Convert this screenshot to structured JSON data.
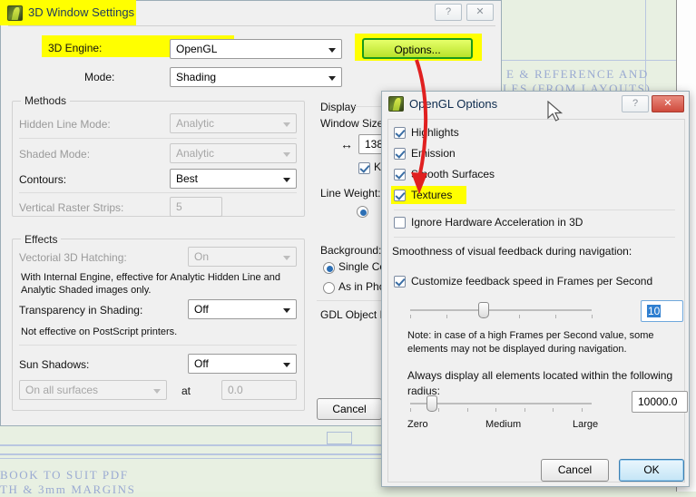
{
  "background_doc": {
    "lines": [
      "E & REFERENCE AND",
      "LES (FROM LAYOUTS)",
      "BOOK TO SUIT PDF",
      "TH & 3mm MARGINS"
    ]
  },
  "settings_window": {
    "title": "3D Window Settings",
    "title_highlighted": true,
    "help_button": "?",
    "close_button": "✕",
    "engine": {
      "label": "3D Engine:",
      "value": "OpenGL",
      "highlighted": true
    },
    "mode": {
      "label": "Mode:",
      "value": "Shading"
    },
    "options_button": {
      "label": "Options...",
      "highlighted": true
    },
    "methods": {
      "title": "Methods",
      "hidden_line_mode": {
        "label": "Hidden Line Mode:",
        "value": "Analytic",
        "disabled": true
      },
      "shaded_mode": {
        "label": "Shaded Mode:",
        "value": "Analytic",
        "disabled": true
      },
      "contours": {
        "label": "Contours:",
        "value": "Best",
        "disabled": false
      },
      "vertical_raster_strips": {
        "label": "Vertical Raster Strips:",
        "value": "5",
        "disabled": true
      }
    },
    "effects": {
      "title": "Effects",
      "vectorial_hatching": {
        "label": "Vectorial 3D Hatching:",
        "value": "On",
        "disabled": true
      },
      "hatching_note": "With Internal Engine, effective for Analytic Hidden Line and Analytic Shaded images only.",
      "transparency": {
        "label": "Transparency in Shading:",
        "value": "Off",
        "disabled": false
      },
      "transparency_note": "Not effective on PostScript printers.",
      "sun_shadows": {
        "label": "Sun Shadows:",
        "value": "Off",
        "disabled": false
      },
      "surfaces": {
        "label": "On all surfaces",
        "disabled": true
      },
      "at_label": "at",
      "at_value": "0.0"
    },
    "display": {
      "title": "Display",
      "window_size_label": "Window Size",
      "width_icon": "↔",
      "width_value": "138",
      "keep_proportions_label": "K",
      "line_weight_label": "Line Weight:",
      "background_label": "Background:",
      "background_option_1": "Single Co",
      "background_option_2": "As in Pho",
      "gdl_label": "GDL Object H"
    },
    "cancel_button": "Cancel"
  },
  "opengl_dialog": {
    "title": "OpenGL Options",
    "help_button": "?",
    "close_button": "✕",
    "checkboxes": [
      {
        "label": "Highlights",
        "checked": true,
        "highlighted": false
      },
      {
        "label": "Emission",
        "checked": true,
        "highlighted": false
      },
      {
        "label": "Smooth Surfaces",
        "checked": true,
        "highlighted": false
      },
      {
        "label": "Textures",
        "checked": true,
        "highlighted": true
      },
      {
        "label": "Ignore Hardware Acceleration in 3D",
        "checked": false,
        "highlighted": false
      }
    ],
    "smoothness_label": "Smoothness of visual feedback during navigation:",
    "customize_fps": {
      "label": "Customize feedback speed in Frames per Second",
      "checked": true
    },
    "fps_value": "10",
    "fps_note": "Note: in case of a high Frames per Second value, some elements may not be displayed during navigation.",
    "radius_label": "Always display all elements located within the following radius:",
    "radius_value": "10000.0",
    "radius_ticks": {
      "zero": "Zero",
      "medium": "Medium",
      "large": "Large"
    },
    "cancel_button": "Cancel",
    "ok_button": "OK"
  },
  "annotation": {
    "arrow_color": "#e02020",
    "highlight_color": "#ffff00",
    "description": "red arrow from Options button to Textures checkbox"
  }
}
